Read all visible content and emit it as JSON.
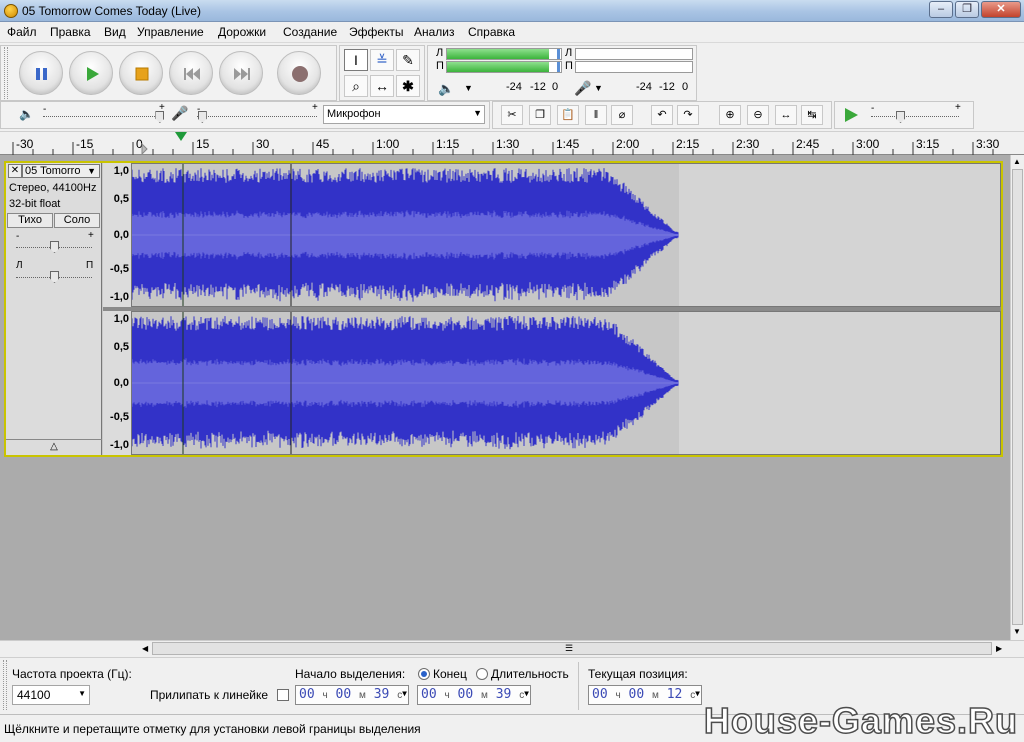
{
  "window": {
    "title": "05 Tomorrow Comes Today (Live)",
    "minimize": "0",
    "maximize": "1",
    "close": "r"
  },
  "menu": [
    "Файл",
    "Правка",
    "Вид",
    "Управление",
    "Дорожки",
    "Создание",
    "Эффекты",
    "Анализ",
    "Справка"
  ],
  "transport": {
    "buttons": [
      {
        "name": "pause",
        "icon": "pause-icon"
      },
      {
        "name": "play",
        "icon": "play-icon"
      },
      {
        "name": "stop",
        "icon": "stop-icon"
      },
      {
        "name": "skip-start",
        "icon": "skip-start-icon"
      },
      {
        "name": "skip-end",
        "icon": "skip-end-icon"
      },
      {
        "name": "record",
        "icon": "record-icon"
      }
    ]
  },
  "tools": {
    "selection": "I",
    "envelope": "≚",
    "draw": "✎",
    "zoom": "⌕",
    "timeshift": "↔",
    "multi": "✱"
  },
  "meters": {
    "play_left": "Л",
    "play_right": "П",
    "rec_left": "Л",
    "rec_right": "П",
    "play_level": 0.88,
    "play_scale": [
      "-24",
      "-12",
      "0"
    ],
    "rec_scale": [
      "-24",
      "-12",
      "0"
    ]
  },
  "mixer": {
    "output_volume_icon": "speaker-icon",
    "input_volume_icon": "microphone-icon",
    "slider_minus": "-",
    "slider_plus": "+",
    "output_volume_level": 0.97,
    "input_volume_level": 0.04,
    "input_device": "Микрофон"
  },
  "edit_tools": [
    "scissors-icon",
    "copy-icon",
    "paste-icon",
    "trim-icon",
    "silence-icon",
    "undo-icon",
    "redo-icon",
    "zoom-in-icon",
    "zoom-out-icon",
    "fit-selection-icon",
    "fit-project-icon"
  ],
  "playback_speed": {
    "minus": "-",
    "plus": "+",
    "level": 0.33
  },
  "ruler": {
    "labels": [
      "-30",
      "-15",
      "0",
      "15",
      "30",
      "45",
      "1:00",
      "1:15",
      "1:30",
      "1:45",
      "2:00",
      "2:15",
      "2:30",
      "2:45",
      "3:00",
      "3:15",
      "3:30"
    ],
    "label_seconds": [
      -30,
      -15,
      0,
      15,
      30,
      45,
      60,
      75,
      90,
      105,
      120,
      135,
      150,
      165,
      180,
      195,
      210
    ],
    "play_head_seconds": 12
  },
  "track": {
    "name": "05 Tomorro",
    "info_line1": "Стерео, 44100Hz",
    "info_line2": "32-bit float",
    "mute": "Тихо",
    "solo": "Соло",
    "gain_minus": "-",
    "gain_plus": "+",
    "pan_left": "Л",
    "pan_right": "П",
    "gain_level": 0.5,
    "pan_level": 0.5,
    "scale_labels": [
      "1,0",
      "0,5",
      "0,0",
      "-0,5",
      "-1,0"
    ],
    "audio_end_seconds": 136
  },
  "selection_bar": {
    "project_rate_label": "Частота проекта (Гц):",
    "project_rate": "44100",
    "snap_label": "Прилипать к линейке",
    "start_label": "Начало выделения:",
    "end_label": "Конец",
    "length_label": "Длительность",
    "position_label": "Текущая позиция:",
    "start": {
      "h": "00",
      "m": "00",
      "s": "39"
    },
    "end": {
      "h": "00",
      "m": "00",
      "s": "39"
    },
    "position": {
      "h": "00",
      "m": "00",
      "s": "12"
    },
    "unit_h": "ч",
    "unit_m": "м",
    "unit_s": "с"
  },
  "status": {
    "text": "Щёлкните и перетащите отметку для установки левой границы выделения"
  },
  "watermark": "House-Games.Ru"
}
